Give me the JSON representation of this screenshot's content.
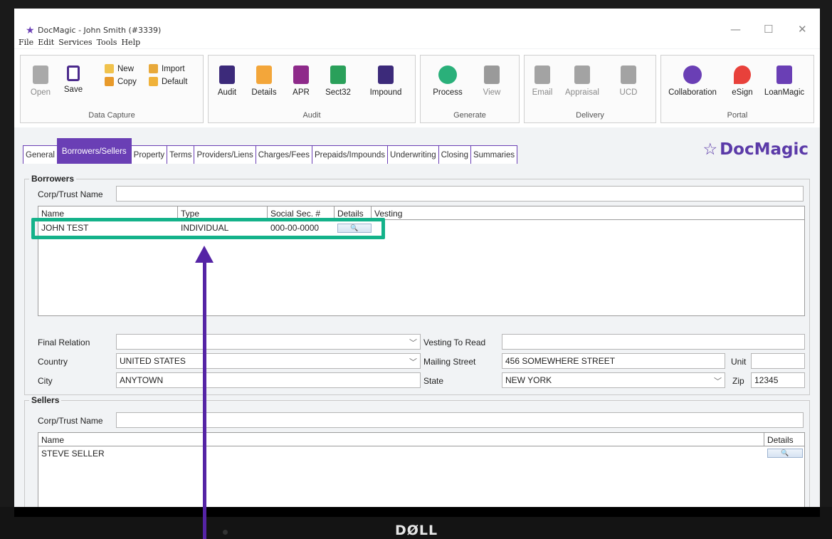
{
  "window": {
    "title": "DocMagic - John Smith (#3339)",
    "controls": {
      "minimize": "—",
      "maximize": "☐",
      "close": "✕"
    }
  },
  "menu": [
    "File",
    "Edit",
    "Services",
    "Tools",
    "Help"
  ],
  "ribbon": {
    "data_capture": {
      "label": "Data Capture",
      "open": "Open",
      "save": "Save",
      "new": "New",
      "copy": "Copy",
      "import": "Import",
      "default": "Default"
    },
    "audit": {
      "label": "Audit",
      "buttons": [
        "Audit",
        "Details",
        "APR",
        "Sect32",
        "Impound"
      ]
    },
    "generate": {
      "label": "Generate",
      "process": "Process",
      "view": "View"
    },
    "delivery": {
      "label": "Delivery",
      "email": "Email",
      "appraisal": "Appraisal",
      "ucd": "UCD"
    },
    "portal": {
      "label": "Portal",
      "collaboration": "Collaboration",
      "esign": "eSign",
      "loanmagic": "LoanMagic"
    }
  },
  "tabs": [
    "General",
    "Borrowers/Sellers",
    "Property",
    "Terms",
    "Providers/Liens",
    "Charges/Fees",
    "Prepaids/Impounds",
    "Underwriting",
    "Closing",
    "Summaries"
  ],
  "active_tab": "Borrowers/Sellers",
  "brand": "DocMagic",
  "borrowers": {
    "legend": "Borrowers",
    "corp_trust_label": "Corp/Trust Name",
    "corp_trust_value": "",
    "columns": {
      "name": "Name",
      "type": "Type",
      "ssn": "Social Sec. #",
      "details": "Details",
      "vesting": "Vesting"
    },
    "rows": [
      {
        "name": "JOHN TEST",
        "type": "INDIVIDUAL",
        "ssn": "000-00-0000",
        "details": "🔍",
        "vesting": ""
      }
    ],
    "final_relation_label": "Final Relation",
    "final_relation_value": "",
    "vesting_to_read_label": "Vesting To Read",
    "vesting_to_read_value": "",
    "country_label": "Country",
    "country_value": "UNITED STATES",
    "mailing_street_label": "Mailing Street",
    "mailing_street_value": "456 SOMEWHERE STREET",
    "unit_label": "Unit",
    "unit_value": "",
    "city_label": "City",
    "city_value": "ANYTOWN",
    "state_label": "State",
    "state_value": "NEW YORK",
    "zip_label": "Zip",
    "zip_value": "12345"
  },
  "sellers": {
    "legend": "Sellers",
    "corp_trust_label": "Corp/Trust Name",
    "corp_trust_value": "",
    "columns": {
      "name": "Name",
      "details": "Details"
    },
    "rows": [
      {
        "name": "STEVE SELLER",
        "details": "🔍"
      }
    ]
  },
  "laptop": {
    "brand": "DØLL"
  },
  "colors": {
    "accent": "#6a3fb5",
    "highlight": "#14b28a",
    "arrow": "#5524a5"
  }
}
